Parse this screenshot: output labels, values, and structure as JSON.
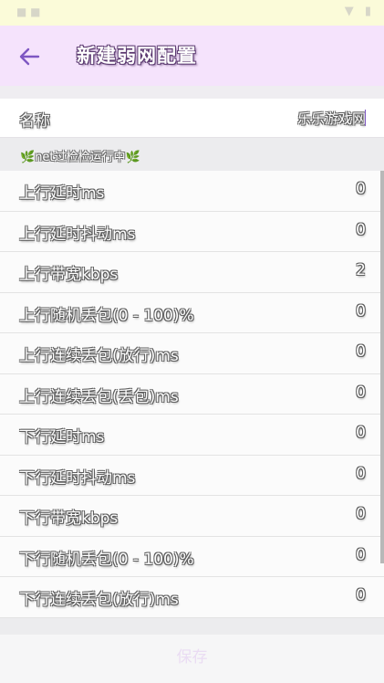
{
  "header": {
    "title": "新建弱网配置",
    "back_icon": "arrow-left-icon",
    "accent_color": "#7e57c2"
  },
  "name_field": {
    "label": "名称",
    "value": "乐乐游戏网"
  },
  "section_header": {
    "left_icon": "🌿",
    "text": "net过检检运行中",
    "right_icon": "🌿"
  },
  "rows": [
    {
      "label": "上行延时ms",
      "value": "0"
    },
    {
      "label": "上行延时抖动ms",
      "value": "0"
    },
    {
      "label": "上行带宽kbps",
      "value": "2"
    },
    {
      "label": "上行随机丢包(0 - 100)%",
      "value": "0"
    },
    {
      "label": "上行连续丢包(放行)ms",
      "value": "0"
    },
    {
      "label": "上行连续丢包(丢包)ms",
      "value": "0"
    },
    {
      "label": "下行延时ms",
      "value": "0"
    },
    {
      "label": "下行延时抖动ms",
      "value": "0"
    },
    {
      "label": "下行带宽kbps",
      "value": "0"
    },
    {
      "label": "下行随机丢包(0 - 100)%",
      "value": "0"
    },
    {
      "label": "下行连续丢包(放行)ms",
      "value": "0"
    }
  ],
  "footer": {
    "save_label": "保存"
  }
}
